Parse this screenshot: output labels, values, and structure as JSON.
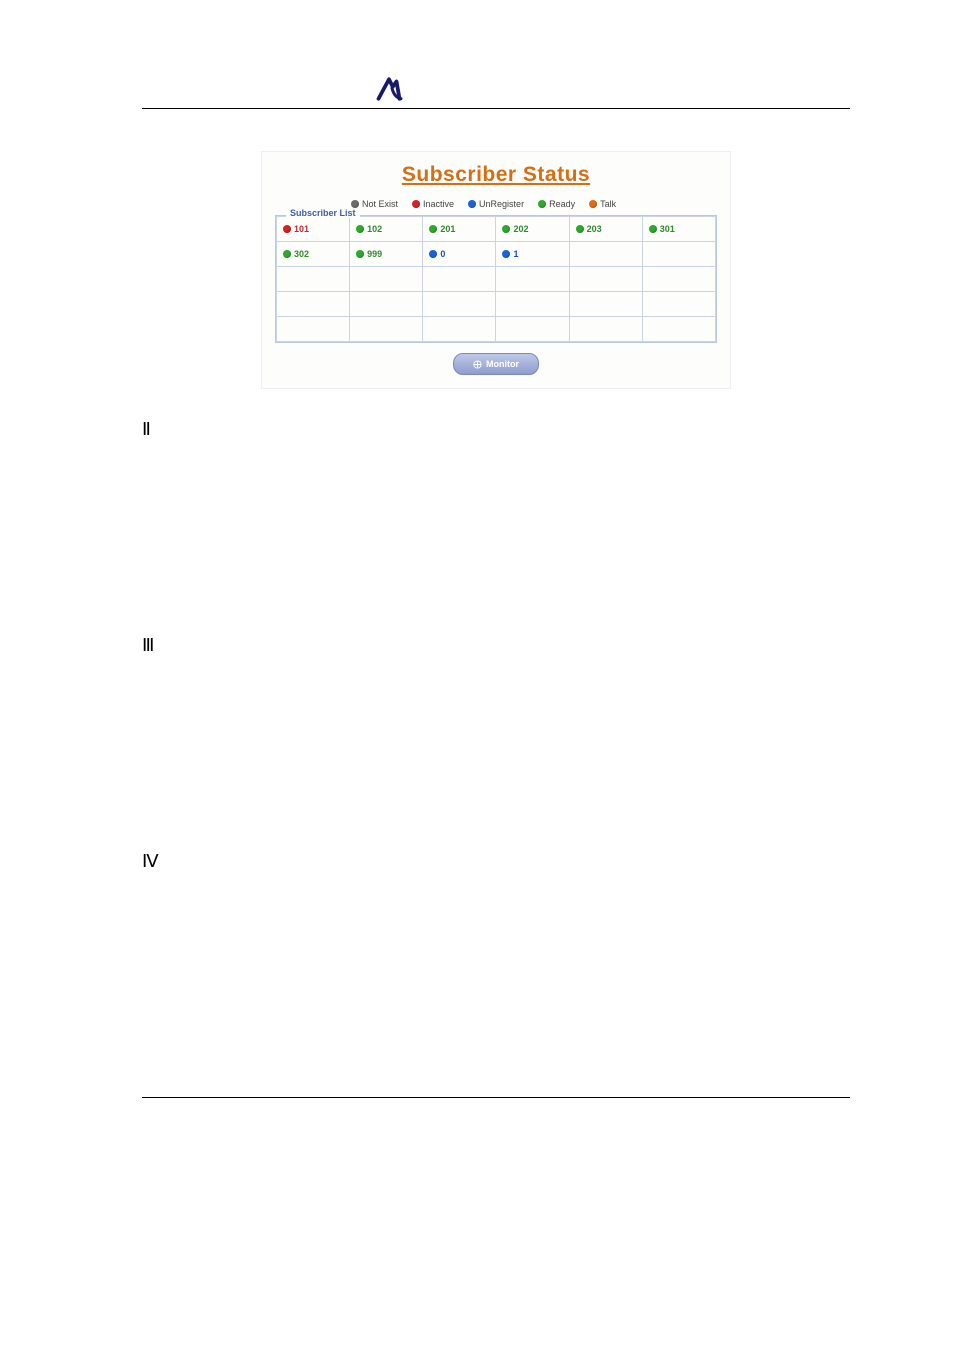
{
  "screenshot": {
    "title": "Subscriber Status",
    "legend": [
      {
        "color": "gray",
        "label": "Not Exist"
      },
      {
        "color": "red",
        "label": "Inactive"
      },
      {
        "color": "blue",
        "label": "UnRegister"
      },
      {
        "color": "green",
        "label": "Ready"
      },
      {
        "color": "orange",
        "label": "Talk"
      }
    ],
    "fieldset_label": "Subscriber List",
    "rows": [
      [
        {
          "dot": "red",
          "text": "101"
        },
        {
          "dot": "green",
          "text": "102"
        },
        {
          "dot": "green",
          "text": "201"
        },
        {
          "dot": "green",
          "text": "202"
        },
        {
          "dot": "green",
          "text": "203"
        },
        {
          "dot": "green",
          "text": "301"
        }
      ],
      [
        {
          "dot": "green",
          "text": "302"
        },
        {
          "dot": "green",
          "text": "999"
        },
        {
          "dot": "blue",
          "text": "0"
        },
        {
          "dot": "blue",
          "text": "1"
        },
        null,
        null
      ],
      [
        null,
        null,
        null,
        null,
        null,
        null
      ],
      [
        null,
        null,
        null,
        null,
        null,
        null
      ],
      [
        null,
        null,
        null,
        null,
        null,
        null
      ]
    ],
    "button_label": "Monitor"
  },
  "markers": {
    "m1": "Ⅱ",
    "m2": "Ⅲ",
    "m3": "Ⅳ"
  }
}
